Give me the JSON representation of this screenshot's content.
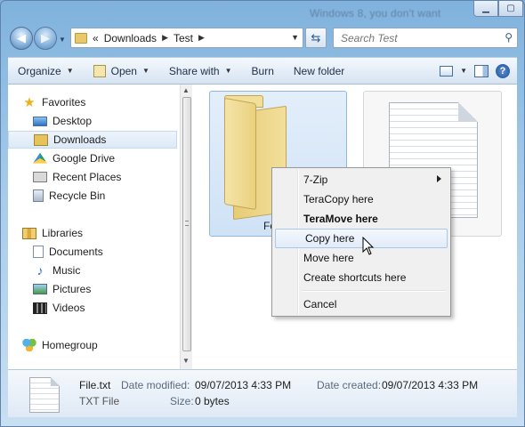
{
  "window": {
    "title": "Windows 8, you don't want"
  },
  "address_bar": {
    "overflow_glyph": "«",
    "segments": [
      "Downloads",
      "Test"
    ]
  },
  "search": {
    "placeholder": "Search Test"
  },
  "command_bar": {
    "organize": "Organize",
    "open": "Open",
    "share_with": "Share with",
    "burn": "Burn",
    "new_folder": "New folder"
  },
  "nav_pane": {
    "favorites": {
      "label": "Favorites",
      "items": [
        {
          "label": "Desktop",
          "icon": "desktop-icon"
        },
        {
          "label": "Downloads",
          "icon": "downloads-folder-icon",
          "selected": true
        },
        {
          "label": "Google Drive",
          "icon": "google-drive-icon"
        },
        {
          "label": "Recent Places",
          "icon": "recent-places-icon"
        },
        {
          "label": "Recycle Bin",
          "icon": "recycle-bin-icon"
        }
      ]
    },
    "libraries": {
      "label": "Libraries",
      "items": [
        {
          "label": "Documents",
          "icon": "documents-icon"
        },
        {
          "label": "Music",
          "icon": "music-icon"
        },
        {
          "label": "Pictures",
          "icon": "pictures-icon"
        },
        {
          "label": "Videos",
          "icon": "videos-icon"
        }
      ]
    },
    "homegroup": {
      "label": "Homegroup"
    }
  },
  "files": [
    {
      "name": "Fo",
      "type": "folder",
      "selected": true
    },
    {
      "name": "",
      "type": "text-document",
      "selected": false
    }
  ],
  "context_menu": {
    "items": [
      {
        "label": "7-Zip",
        "submenu": true
      },
      {
        "label": "TeraCopy here"
      },
      {
        "label": "TeraMove here",
        "bold": true
      },
      {
        "label": "Copy here",
        "hover": true
      },
      {
        "label": "Move here"
      },
      {
        "label": "Create shortcuts here"
      },
      {
        "label": "Cancel"
      }
    ]
  },
  "details": {
    "name": "File.txt",
    "type": "TXT File",
    "date_modified_label": "Date modified:",
    "date_modified": "09/07/2013 4:33 PM",
    "date_created_label": "Date created:",
    "date_created": "09/07/2013 4:33 PM",
    "size_label": "Size:",
    "size": "0 bytes"
  },
  "colors": {
    "accent": "#3a6ea5",
    "selection": "#cfe2f6",
    "menu_hover_border": "#a8c7ea"
  }
}
